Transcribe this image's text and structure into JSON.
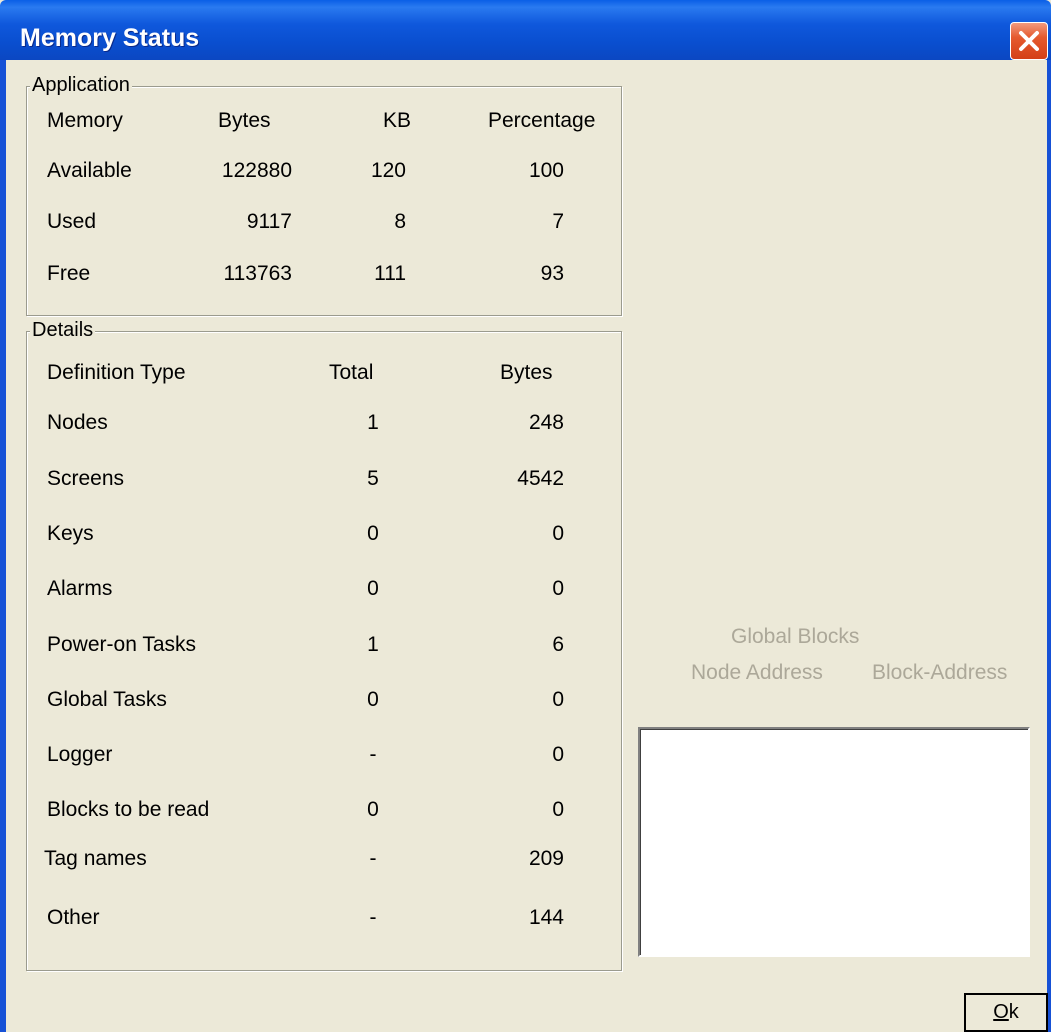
{
  "window": {
    "title": "Memory Status",
    "accent_color": "#0A4FD0",
    "close_icon": "close-icon"
  },
  "application": {
    "label": "Application",
    "headers": [
      "Memory",
      "Bytes",
      "KB",
      "Percentage"
    ],
    "rows": [
      {
        "name": "Available",
        "bytes": "122880",
        "kb": "120",
        "pct": "100"
      },
      {
        "name": "Used",
        "bytes": "9117",
        "kb": "8",
        "pct": "7"
      },
      {
        "name": "Free",
        "bytes": "113763",
        "kb": "111",
        "pct": "93"
      }
    ]
  },
  "details": {
    "label": "Details",
    "headers": [
      "Definition Type",
      "Total",
      "Bytes"
    ],
    "rows": [
      {
        "name": "Nodes",
        "total": "1",
        "bytes": "248"
      },
      {
        "name": "Screens",
        "total": "5",
        "bytes": "4542"
      },
      {
        "name": "Keys",
        "total": "0",
        "bytes": "0"
      },
      {
        "name": "Alarms",
        "total": "0",
        "bytes": "0"
      },
      {
        "name": "Power-on Tasks",
        "total": "1",
        "bytes": "6"
      },
      {
        "name": "Global Tasks",
        "total": "0",
        "bytes": "0"
      },
      {
        "name": "Logger",
        "total": "-",
        "bytes": "0"
      },
      {
        "name": "Blocks to be read",
        "total": "0",
        "bytes": "0"
      },
      {
        "name": "Tag names",
        "total": "-",
        "bytes": "209"
      },
      {
        "name": "Other",
        "total": "-",
        "bytes": "144"
      }
    ]
  },
  "global_blocks": {
    "title": "Global Blocks",
    "col_node": "Node Address",
    "col_block": "Block-Address"
  },
  "buttons": {
    "ok_label": "Ok"
  }
}
